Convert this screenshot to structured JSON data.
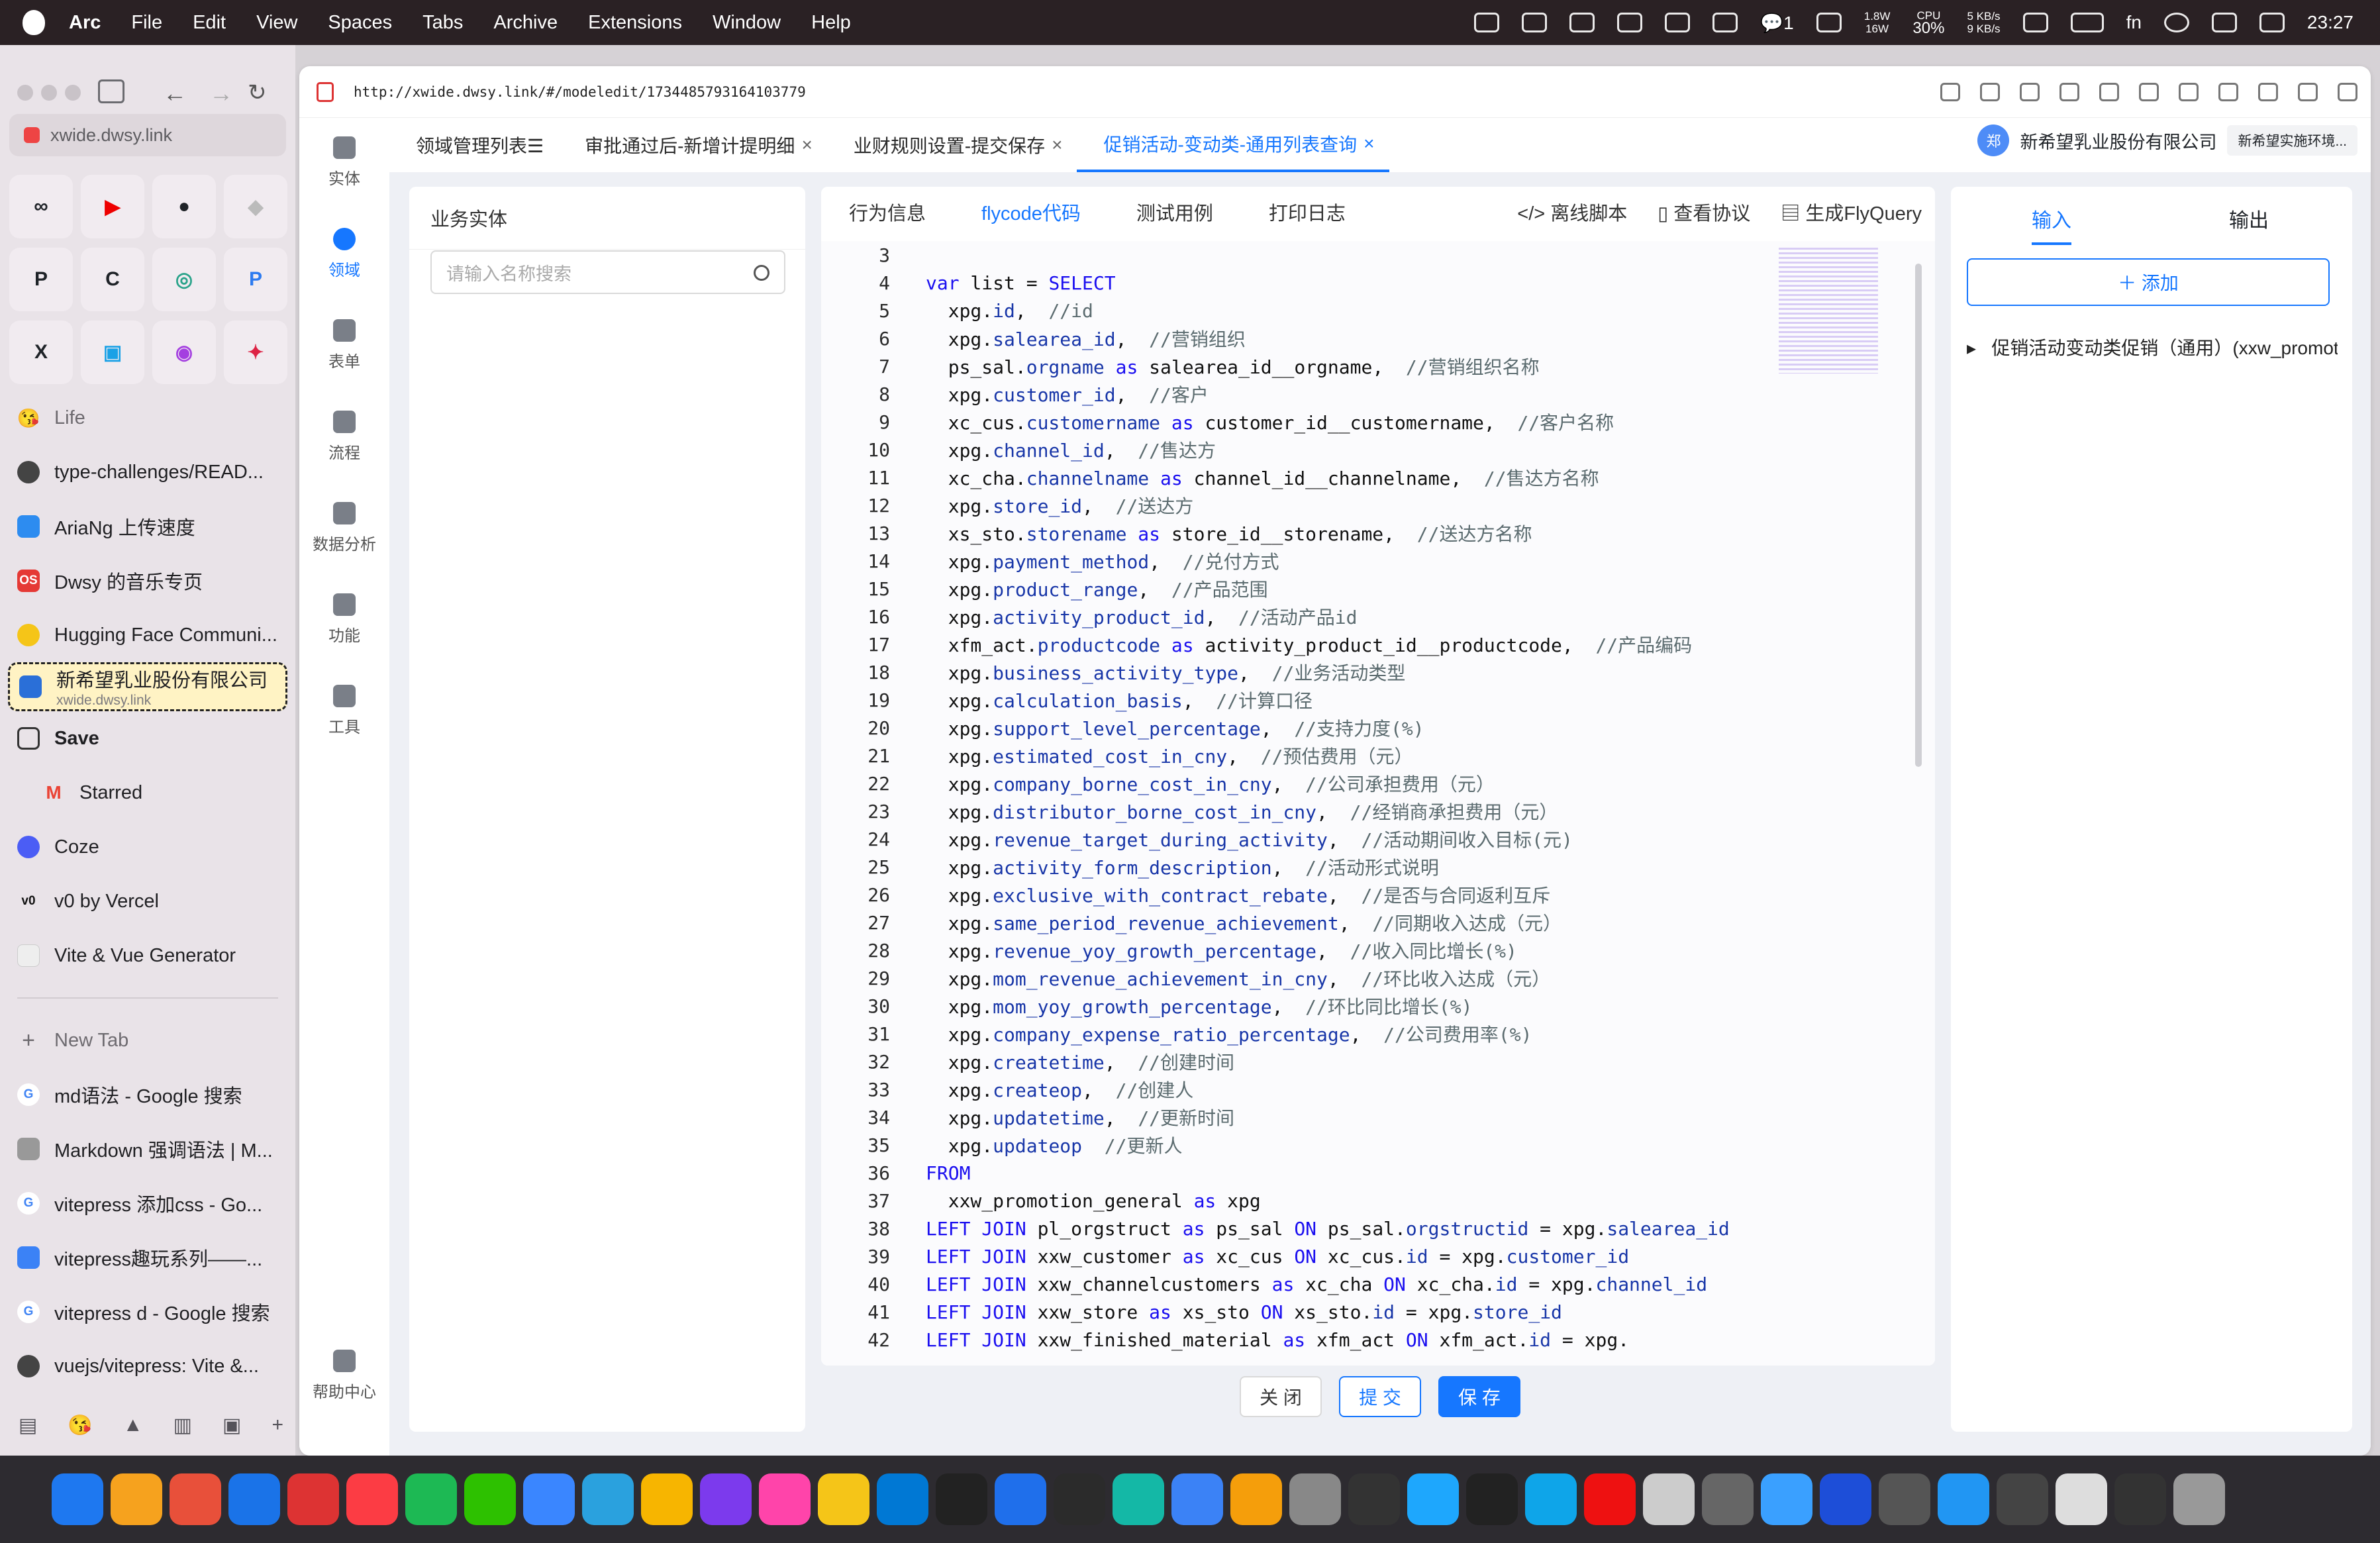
{
  "menubar": {
    "app": "Arc",
    "items": [
      "File",
      "Edit",
      "View",
      "Spaces",
      "Tabs",
      "Archive",
      "Extensions",
      "Window",
      "Help"
    ],
    "net_up": "1.8W",
    "net_down": "16W",
    "cpu_label": "CPU",
    "cpu": "30%",
    "speed_up": "5 KB/s",
    "speed_down": "9 KB/s",
    "notif_count": "1",
    "fn": "fn",
    "time": "23:27"
  },
  "arc": {
    "url_host": "xwide.dwsy.link",
    "favs": [
      "∞",
      "▶",
      "●",
      "◆",
      "P",
      "C",
      "◎",
      "P",
      "X",
      "▣",
      "◉",
      "✦"
    ],
    "items": [
      {
        "label": "Life",
        "kind": "sect",
        "icon": "😘",
        "color": "#f5a623"
      },
      {
        "label": "type-challenges/READ...",
        "icon": "●",
        "color": "#444"
      },
      {
        "label": "AriaNg 上传速度",
        "icon": "☁",
        "color": "#2d8cf0"
      },
      {
        "label": "Dwsy 的音乐专页",
        "icon": "OS",
        "color": "#e53935"
      },
      {
        "label": "Hugging Face Communi...",
        "icon": "☺",
        "color": "#f5c518"
      }
    ],
    "active": {
      "title": "新希望乳业股份有限公司",
      "sub": "xwide.dwsy.link"
    },
    "save": "Save",
    "items2": [
      {
        "label": "Starred",
        "icon": "M",
        "color": "#ea4335",
        "sub": true
      },
      {
        "label": "Coze",
        "icon": "C",
        "color": "#4b5df5"
      },
      {
        "label": "v0 by Vercel",
        "icon": "v0",
        "color": "#111"
      },
      {
        "label": "Vite & Vue Generator",
        "icon": "V",
        "color": "#ccc"
      }
    ],
    "newtab": "New Tab",
    "items3": [
      {
        "label": "md语法 - Google 搜索",
        "icon": "G",
        "color": "#4285f4"
      },
      {
        "label": "Markdown 强调语法 | M...",
        "icon": "M",
        "color": "#999"
      },
      {
        "label": "vitepress 添加css - Go...",
        "icon": "G",
        "color": "#4285f4"
      },
      {
        "label": "vitepress趣玩系列——...",
        "icon": "≈",
        "color": "#3b82f6"
      },
      {
        "label": "vitepress d - Google 搜索",
        "icon": "G",
        "color": "#4285f4"
      },
      {
        "label": "vuejs/vitepress: Vite &...",
        "icon": "●",
        "color": "#444"
      }
    ]
  },
  "url": "http://xwide.dwsy.link/#/modeledit/1734485793164103779",
  "nav": [
    "实体",
    "领域",
    "表单",
    "流程",
    "数据分析",
    "功能",
    "工具"
  ],
  "help": "帮助中心",
  "tabs": [
    {
      "label": "领域管理列表☰",
      "x": false
    },
    {
      "label": "审批通过后-新增计提明细",
      "x": true
    },
    {
      "label": "业财规则设置-提交保存",
      "x": true
    },
    {
      "label": "促销活动-变动类-通用列表查询",
      "x": true,
      "on": true
    }
  ],
  "org": {
    "avatar": "郑",
    "name": "新希望乳业股份有限公司",
    "env": "新希望实施环境..."
  },
  "entity": {
    "title": "业务实体",
    "placeholder": "请输入名称搜索"
  },
  "editor_tabs": [
    "行为信息",
    "flycode代码",
    "测试用例",
    "打印日志"
  ],
  "editor_actions": [
    "</> 离线脚本",
    "查看协议",
    "生成FlyQuery"
  ],
  "buttons": {
    "close": "关 闭",
    "submit": "提 交",
    "save": "保 存"
  },
  "right": {
    "tab_in": "输入",
    "tab_out": "输出",
    "add": "＋ 添加",
    "node": "促销活动变动类促销（通用）(xxw_promoti"
  },
  "colors": {
    "accent": "#1677ff"
  },
  "code": [
    {
      "n": "3",
      "t": ""
    },
    {
      "n": "4",
      "t": "var list = SELECT"
    },
    {
      "n": "5",
      "t": "  xpg.id,  //id"
    },
    {
      "n": "6",
      "t": "  xpg.salearea_id,  //营销组织"
    },
    {
      "n": "7",
      "t": "  ps_sal.orgname as salearea_id__orgname,  //营销组织名称"
    },
    {
      "n": "8",
      "t": "  xpg.customer_id,  //客户"
    },
    {
      "n": "9",
      "t": "  xc_cus.customername as customer_id__customername,  //客户名称"
    },
    {
      "n": "10",
      "t": "  xpg.channel_id,  //售达方"
    },
    {
      "n": "11",
      "t": "  xc_cha.channelname as channel_id__channelname,  //售达方名称"
    },
    {
      "n": "12",
      "t": "  xpg.store_id,  //送达方"
    },
    {
      "n": "13",
      "t": "  xs_sto.storename as store_id__storename,  //送达方名称"
    },
    {
      "n": "14",
      "t": "  xpg.payment_method,  //兑付方式"
    },
    {
      "n": "15",
      "t": "  xpg.product_range,  //产品范围"
    },
    {
      "n": "16",
      "t": "  xpg.activity_product_id,  //活动产品id"
    },
    {
      "n": "17",
      "t": "  xfm_act.productcode as activity_product_id__productcode,  //产品编码"
    },
    {
      "n": "18",
      "t": "  xpg.business_activity_type,  //业务活动类型"
    },
    {
      "n": "19",
      "t": "  xpg.calculation_basis,  //计算口径"
    },
    {
      "n": "20",
      "t": "  xpg.support_level_percentage,  //支持力度(%)"
    },
    {
      "n": "21",
      "t": "  xpg.estimated_cost_in_cny,  //预估费用（元）"
    },
    {
      "n": "22",
      "t": "  xpg.company_borne_cost_in_cny,  //公司承担费用（元）"
    },
    {
      "n": "23",
      "t": "  xpg.distributor_borne_cost_in_cny,  //经销商承担费用（元）"
    },
    {
      "n": "24",
      "t": "  xpg.revenue_target_during_activity,  //活动期间收入目标(元)"
    },
    {
      "n": "25",
      "t": "  xpg.activity_form_description,  //活动形式说明"
    },
    {
      "n": "26",
      "t": "  xpg.exclusive_with_contract_rebate,  //是否与合同返利互斥"
    },
    {
      "n": "27",
      "t": "  xpg.same_period_revenue_achievement,  //同期收入达成（元）"
    },
    {
      "n": "28",
      "t": "  xpg.revenue_yoy_growth_percentage,  //收入同比增长(%)"
    },
    {
      "n": "29",
      "t": "  xpg.mom_revenue_achievement_in_cny,  //环比收入达成（元）"
    },
    {
      "n": "30",
      "t": "  xpg.mom_yoy_growth_percentage,  //环比同比增长(%)"
    },
    {
      "n": "31",
      "t": "  xpg.company_expense_ratio_percentage,  //公司费用率(%)"
    },
    {
      "n": "32",
      "t": "  xpg.createtime,  //创建时间"
    },
    {
      "n": "33",
      "t": "  xpg.createop,  //创建人"
    },
    {
      "n": "34",
      "t": "  xpg.updatetime,  //更新时间"
    },
    {
      "n": "35",
      "t": "  xpg.updateop  //更新人"
    },
    {
      "n": "36",
      "t": "FROM"
    },
    {
      "n": "37",
      "t": "  xxw_promotion_general as xpg"
    },
    {
      "n": "38",
      "t": "LEFT JOIN pl_orgstruct as ps_sal ON ps_sal.orgstructid = xpg.salearea_id"
    },
    {
      "n": "39",
      "t": "LEFT JOIN xxw_customer as xc_cus ON xc_cus.id = xpg.customer_id"
    },
    {
      "n": "40",
      "t": "LEFT JOIN xxw_channelcustomers as xc_cha ON xc_cha.id = xpg.channel_id"
    },
    {
      "n": "41",
      "t": "LEFT JOIN xxw_store as xs_sto ON xs_sto.id = xpg.store_id"
    },
    {
      "n": "42",
      "t": "LEFT JOIN xxw_finished_material as xfm_act ON xfm_act.id = xpg."
    }
  ]
}
